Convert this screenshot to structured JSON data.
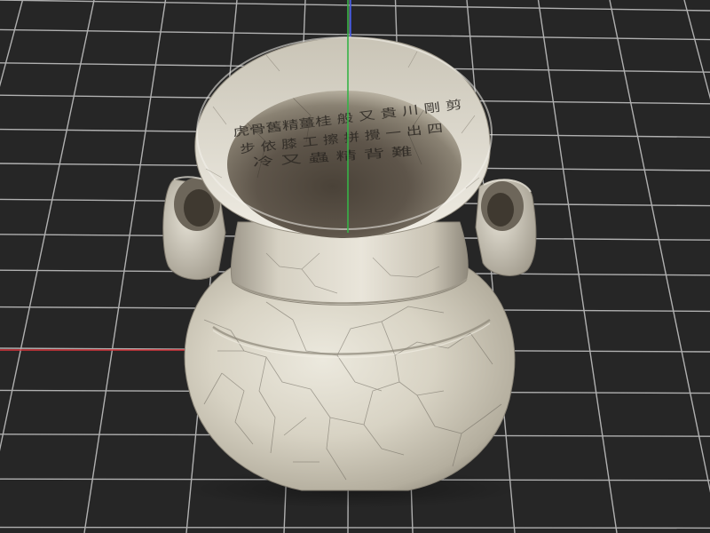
{
  "viewport": {
    "background_color": "#262626",
    "grid_color": "#c9c9c9",
    "axis_colors": {
      "x": "#d8343a",
      "y": "#37b347",
      "z": "#3a50e0"
    },
    "model": {
      "name": "celadon crackle-glaze jar with two tubular handles",
      "glaze_color": "#d7d3c6",
      "crackle_color": "#6b665c",
      "inscription_color": "#2b2722",
      "inscription_rows": [
        "虎骨舊精薑桂 般 又 貴 川 剛 剪",
        "步 依 膝 工 擦 拼 攪 一 出 四",
        "冷 又 蟲 精 背 難"
      ]
    }
  }
}
